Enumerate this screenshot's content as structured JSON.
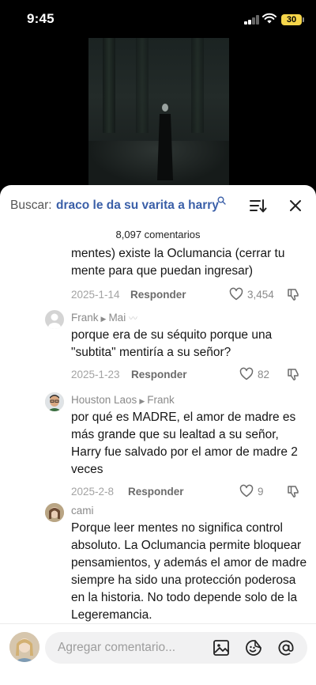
{
  "status_bar": {
    "time": "9:45",
    "battery": "30"
  },
  "comments_panel": {
    "search_label": "Buscar:",
    "search_term": "draco le da su varita a harry",
    "count": "8,097 comentarios"
  },
  "comments": [
    {
      "author": "",
      "text": "mentes) existe la Oclumancia (cerrar tu mente para que puedan ingresar)",
      "date": "2025-1-14",
      "reply": "Responder",
      "likes": "3,454"
    },
    {
      "author": "Frank",
      "reply_to": "Mai",
      "text": "porque era de su séquito porque una \"subtita\" mentiría a su señor?",
      "date": "2025-1-23",
      "reply": "Responder",
      "likes": "82"
    },
    {
      "author": "Houston Laos",
      "reply_to": "Frank",
      "text": "por qué es MADRE, el amor de madre es más grande que su lealtad a su señor, Harry fue salvado por el amor de madre 2 veces",
      "date": "2025-2-8",
      "reply": "Responder",
      "likes": "9"
    },
    {
      "author": "cami",
      "text": "Porque leer mentes no significa control absoluto. La Oclumancia permite bloquear pensamientos, y además el amor de madre siempre ha sido una protección poderosa en la historia. No todo depende solo de la Legeremancia."
    }
  ],
  "input": {
    "placeholder": "Agregar comentario..."
  },
  "colors": {
    "search_term": "#3a5fa8",
    "battery": "#f5d54a",
    "sheet_bg": "#ffffff"
  }
}
